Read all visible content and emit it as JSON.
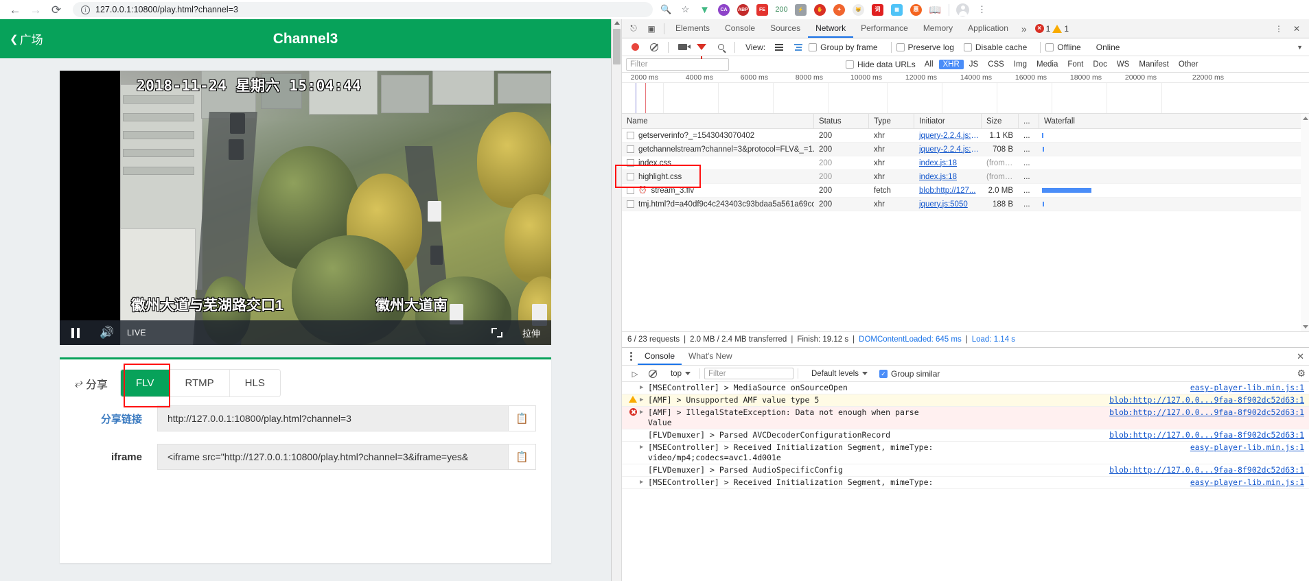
{
  "browser": {
    "back_icon": "back-arrow",
    "forward_icon": "forward-arrow",
    "reload_icon": "reload",
    "url": "127.0.0.1:10800/play.html?channel=3",
    "zoom_icon": "zoom-in",
    "bookmark_icon": "star",
    "extensions": [
      {
        "name": "vue-devtools",
        "label": "V",
        "color": "#41b883",
        "shape": "glyph"
      },
      {
        "name": "ca-extension",
        "label": "CA",
        "color": "#8e44c9",
        "shape": "circle"
      },
      {
        "name": "adblock-plus",
        "label": "ABP",
        "color": "#c32b2b",
        "shape": "circle"
      },
      {
        "name": "fe-helper",
        "label": "FE",
        "color": "#e3342f",
        "shape": "square"
      },
      {
        "name": "status-code-200",
        "label": "200",
        "color": "#3a8a5a",
        "shape": "text"
      },
      {
        "name": "tampermonkey",
        "label": "",
        "color": "#9aa0a6",
        "shape": "square"
      },
      {
        "name": "block-extension",
        "label": "",
        "color": "#d93025",
        "shape": "octagon"
      },
      {
        "name": "firefox-like-extension",
        "label": "",
        "color": "#f0652f",
        "shape": "circle"
      },
      {
        "name": "cat-extension",
        "label": "",
        "color": "#efefef",
        "shape": "circle"
      },
      {
        "name": "youdao-extension",
        "label": "词",
        "color": "#e02020",
        "shape": "square"
      },
      {
        "name": "qr-extension",
        "label": "",
        "color": "#4fc3f7",
        "shape": "square"
      },
      {
        "name": "taobao-extension",
        "label": "惠",
        "color": "#f4641f",
        "shape": "circle"
      },
      {
        "name": "search-doc-extension",
        "label": "",
        "color": "#5f6368",
        "shape": "square"
      }
    ],
    "profile_icon": "avatar",
    "menu_icon": "kebab-menu"
  },
  "page": {
    "header": {
      "back_label": "广场",
      "title": "Channel3",
      "green": "#07a25a"
    },
    "video": {
      "timestamp": "2018-11-24  星期六  15:04:44",
      "caption_left": "徽州大道与芜湖路交口1",
      "caption_right": "徽州大道南",
      "pause_icon": "pause",
      "volume_icon": "volume",
      "live_label": "LIVE",
      "fullscreen_icon": "fullscreen",
      "stretch_label": "拉伸"
    },
    "share": {
      "share_icon": "share-arrow",
      "title": "分享",
      "protocol_tabs": [
        {
          "label": "FLV",
          "active": true
        },
        {
          "label": "RTMP",
          "active": false
        },
        {
          "label": "HLS",
          "active": false
        }
      ],
      "rows": [
        {
          "label": "分享链接",
          "value": "http://127.0.0.1:10800/play.html?channel=3",
          "copy_icon": "copy"
        },
        {
          "label": "iframe",
          "value": "<iframe src=\"http://127.0.0.1:10800/play.html?channel=3&iframe=yes&",
          "copy_icon": "copy"
        }
      ]
    }
  },
  "devtools": {
    "inspect_icon": "inspect-cursor",
    "device_icon": "device-toggle",
    "tabs": [
      {
        "label": "Elements",
        "active": false
      },
      {
        "label": "Console",
        "active": false
      },
      {
        "label": "Sources",
        "active": false
      },
      {
        "label": "Network",
        "active": true
      },
      {
        "label": "Performance",
        "active": false
      },
      {
        "label": "Memory",
        "active": false
      },
      {
        "label": "Application",
        "active": false
      }
    ],
    "more_tabs_icon": "chevron-double-right",
    "error_count": "1",
    "warning_count": "1",
    "settings_icon": "kebab-menu",
    "close_icon": "close",
    "network_toolbar": {
      "record_icon": "record",
      "clear_icon": "clear",
      "capture_screenshots_icon": "camera",
      "filter_icon": "funnel",
      "search_icon": "search",
      "view_label": "View:",
      "list_view_icon": "list-view",
      "waterfall_view_icon": "waterfall-view",
      "group_by_frame": "Group by frame",
      "preserve_log": "Preserve log",
      "disable_cache": "Disable cache",
      "offline": "Offline",
      "throttle": "Online",
      "throttle_caret": "chevron-down"
    },
    "filter_bar": {
      "placeholder": "Filter",
      "hide_data_urls": "Hide data URLs",
      "types": [
        {
          "label": "All",
          "selected": false
        },
        {
          "label": "XHR",
          "selected": true
        },
        {
          "label": "JS",
          "selected": false
        },
        {
          "label": "CSS",
          "selected": false
        },
        {
          "label": "Img",
          "selected": false
        },
        {
          "label": "Media",
          "selected": false
        },
        {
          "label": "Font",
          "selected": false
        },
        {
          "label": "Doc",
          "selected": false
        },
        {
          "label": "WS",
          "selected": false
        },
        {
          "label": "Manifest",
          "selected": false
        },
        {
          "label": "Other",
          "selected": false
        }
      ]
    },
    "overview_ticks": [
      "2000 ms",
      "4000 ms",
      "6000 ms",
      "8000 ms",
      "10000 ms",
      "12000 ms",
      "14000 ms",
      "16000 ms",
      "18000 ms",
      "20000 ms",
      "22000 ms"
    ],
    "network_columns": [
      "Name",
      "Status",
      "Type",
      "Initiator",
      "Size",
      "...",
      "Waterfall"
    ],
    "network_rows": [
      {
        "name": "getserverinfo?_=1543043070402",
        "status": "200",
        "type": "xhr",
        "initiator": "jquery-2.2.4.js:9...",
        "size": "1.1 KB",
        "time": "...",
        "dim": false,
        "highlight": false
      },
      {
        "name": "getchannelstream?channel=3&protocol=FLV&_=1...",
        "status": "200",
        "type": "xhr",
        "initiator": "jquery-2.2.4.js:9...",
        "size": "708 B",
        "time": "...",
        "dim": false,
        "highlight": false
      },
      {
        "name": "index.css",
        "status": "200",
        "type": "xhr",
        "initiator": "index.js:18",
        "size": "(from ...",
        "time": "...",
        "dim": true,
        "highlight": false
      },
      {
        "name": "highlight.css",
        "status": "200",
        "type": "xhr",
        "initiator": "index.js:18",
        "size": "(from ...",
        "time": "...",
        "dim": true,
        "highlight": false
      },
      {
        "name": "stream_3.flv",
        "status": "200",
        "type": "fetch",
        "initiator": "blob:http://127...",
        "size": "2.0 MB",
        "time": "...",
        "dim": false,
        "highlight": true
      },
      {
        "name": "tmj.html?d=a40df9c4c243403c93bdaa5a561a69cc...",
        "status": "200",
        "type": "xhr",
        "initiator": "jquery.js:5050",
        "size": "188 B",
        "time": "...",
        "dim": false,
        "highlight": false
      }
    ],
    "summary": {
      "requests": "6 / 23 requests",
      "transferred": "2.0 MB / 2.4 MB transferred",
      "finish": "Finish: 19.12 s",
      "dcl": "DOMContentLoaded: 645 ms",
      "load": "Load: 1.14 s"
    },
    "drawer": {
      "menu_icon": "kebab-menu",
      "tabs": [
        {
          "label": "Console",
          "active": true
        },
        {
          "label": "What's New",
          "active": false
        }
      ],
      "close_icon": "close",
      "toolbar": {
        "clear_icon": "clear",
        "block_icon": "block",
        "context": "top",
        "context_caret": "chevron-down",
        "filter_placeholder": "Filter",
        "levels": "Default levels",
        "levels_caret": "chevron-down",
        "group_similar": "Group similar",
        "settings_icon": "gear"
      },
      "logs": [
        {
          "level": "info",
          "expandable": true,
          "text": "[MSEController] > MediaSource onSourceOpen",
          "source": "easy-player-lib.min.js:1"
        },
        {
          "level": "warn",
          "expandable": true,
          "text": "[AMF] > Unsupported AMF value type 5",
          "source": "blob:http://127.0.0...9faa-8f902dc52d63:1"
        },
        {
          "level": "error",
          "expandable": true,
          "text": "[AMF] > IllegalStateException: Data not enough when parse\nValue",
          "source": "blob:http://127.0.0...9faa-8f902dc52d63:1"
        },
        {
          "level": "info",
          "expandable": false,
          "text": "[FLVDemuxer] > Parsed AVCDecoderConfigurationRecord",
          "source": "blob:http://127.0.0...9faa-8f902dc52d63:1"
        },
        {
          "level": "info",
          "expandable": true,
          "text": "[MSEController] > Received Initialization Segment, mimeType:\nvideo/mp4;codecs=avc1.4d001e",
          "source": "easy-player-lib.min.js:1"
        },
        {
          "level": "info",
          "expandable": false,
          "text": "[FLVDemuxer] > Parsed AudioSpecificConfig",
          "source": "blob:http://127.0.0...9faa-8f902dc52d63:1"
        },
        {
          "level": "info",
          "expandable": true,
          "text": "[MSEController] > Received Initialization Segment, mimeType:",
          "source": "easy-player-lib.min.js:1"
        }
      ]
    }
  }
}
